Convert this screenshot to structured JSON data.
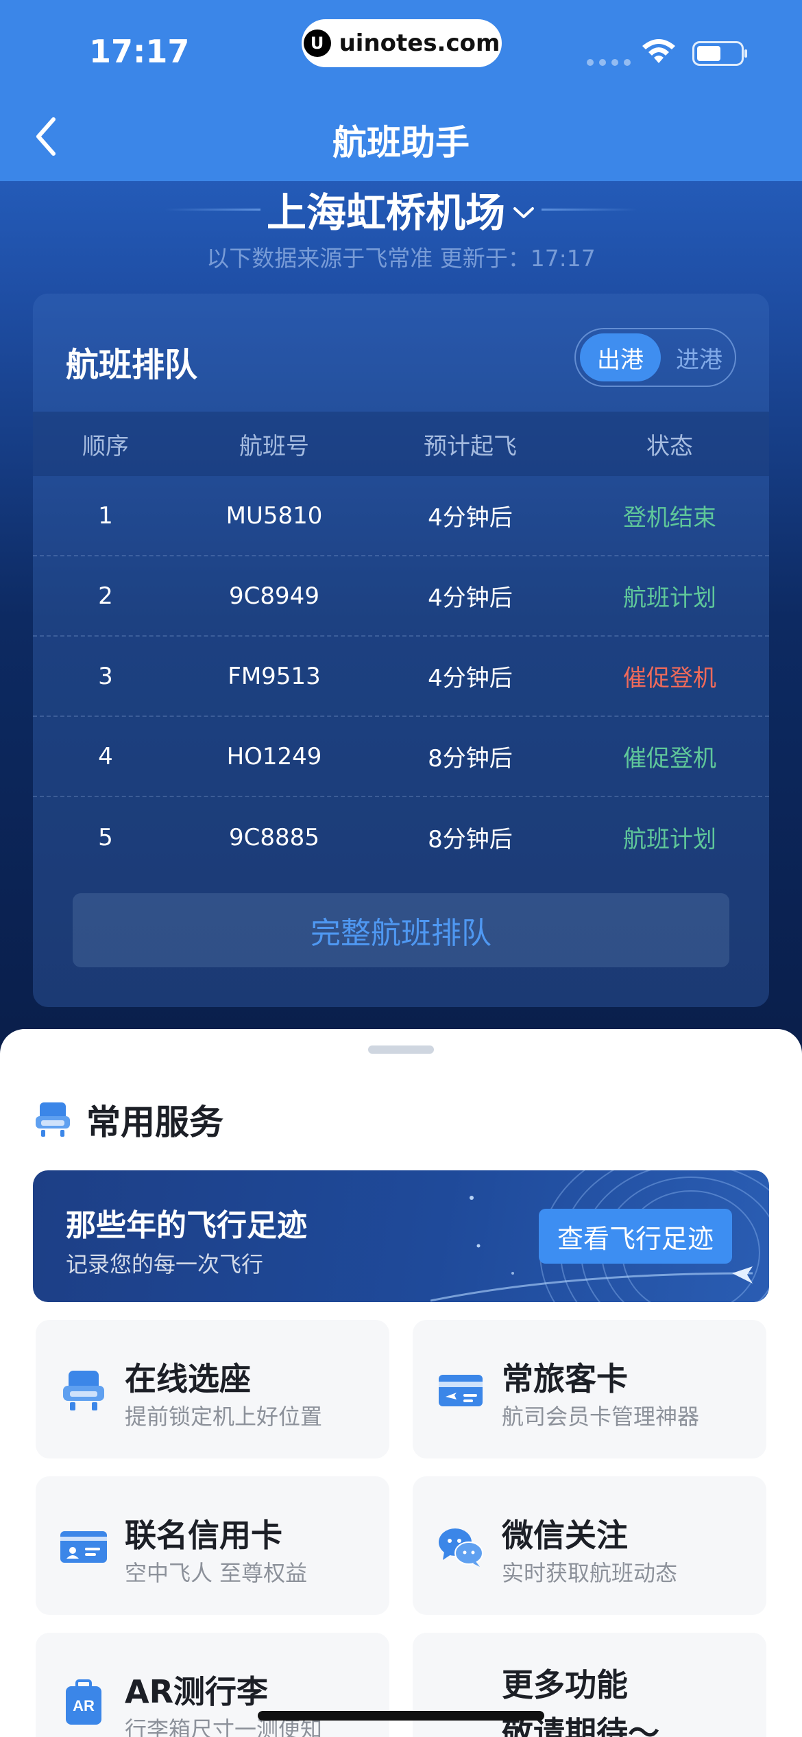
{
  "status_bar": {
    "time": "17:17",
    "url": "uinotes.com",
    "url_logo": "U"
  },
  "nav": {
    "title": "航班助手",
    "back_icon": "chevron-left-icon"
  },
  "airport": {
    "name": "上海虹桥机场",
    "source_note": "以下数据来源于飞常准 更新于：17:17"
  },
  "queue": {
    "title": "航班排队",
    "toggle": {
      "active": "出港",
      "inactive": "进港"
    },
    "columns": [
      "顺序",
      "航班号",
      "预计起飞",
      "状态"
    ],
    "rows": [
      {
        "order": "1",
        "flight": "MU5810",
        "eta": "4分钟后",
        "status": "登机结束",
        "status_color": "green"
      },
      {
        "order": "2",
        "flight": "9C8949",
        "eta": "4分钟后",
        "status": "航班计划",
        "status_color": "green"
      },
      {
        "order": "3",
        "flight": "FM9513",
        "eta": "4分钟后",
        "status": "催促登机",
        "status_color": "red"
      },
      {
        "order": "4",
        "flight": "HO1249",
        "eta": "8分钟后",
        "status": "催促登机",
        "status_color": "green"
      },
      {
        "order": "5",
        "flight": "9C8885",
        "eta": "8分钟后",
        "status": "航班计划",
        "status_color": "green"
      }
    ],
    "full_button": "完整航班排队"
  },
  "services": {
    "title": "常用服务",
    "banner": {
      "title": "那些年的飞行足迹",
      "subtitle": "记录您的每一次飞行",
      "button": "查看飞行足迹"
    },
    "tiles": [
      {
        "title": "在线选座",
        "subtitle": "提前锁定机上好位置",
        "icon": "seat-icon"
      },
      {
        "title": "常旅客卡",
        "subtitle": "航司会员卡管理神器",
        "icon": "boarding-card-icon"
      },
      {
        "title": "联名信用卡",
        "subtitle": "空中飞人 至尊权益",
        "icon": "credit-card-icon"
      },
      {
        "title": "微信关注",
        "subtitle": "实时获取航班动态",
        "icon": "wechat-icon"
      },
      {
        "title": "AR测行李",
        "subtitle": "行李箱尺寸一测便知",
        "icon": "ar-luggage-icon"
      },
      {
        "title": "更多功能",
        "subtitle": "敬请期待～",
        "icon": ""
      }
    ]
  },
  "colors": {
    "primary": "#3b86e8",
    "status_green": "#5fc79a",
    "status_red": "#f06a5a"
  }
}
